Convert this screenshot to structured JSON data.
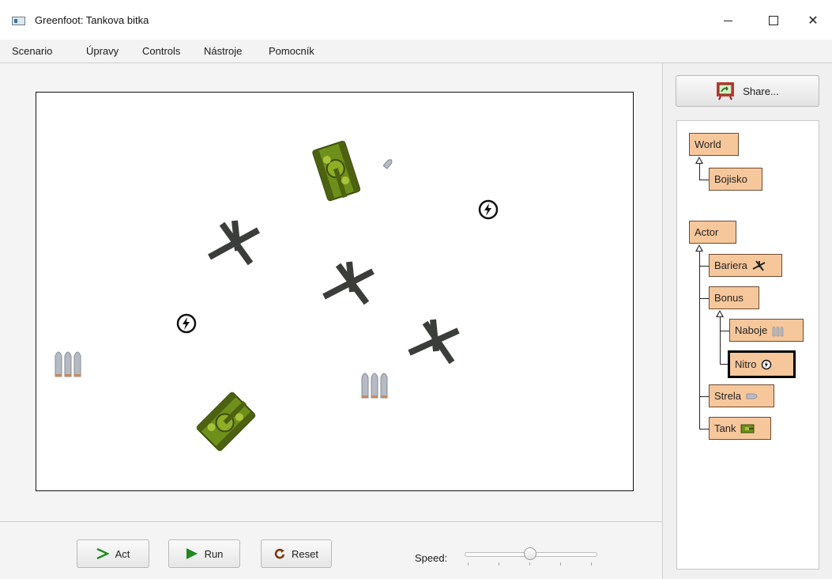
{
  "window": {
    "title": "Greenfoot: Tankova bitka",
    "minimize_glyph": "—",
    "maximize_glyph": "☐",
    "close_glyph": "✕"
  },
  "menu": [
    "Scenario",
    "Úpravy",
    "Controls",
    "Nástroje",
    "Pomocník"
  ],
  "controls": {
    "act_label": "Act",
    "run_label": "Run",
    "reset_label": "Reset",
    "speed_label": "Speed:",
    "speed_level": 0.5
  },
  "share": {
    "label": "Share..."
  },
  "class_tree": {
    "world_root": "World",
    "world_sub": "Bojisko",
    "actor_root": "Actor",
    "bariera": "Bariera",
    "bonus": "Bonus",
    "naboje": "Naboje",
    "nitro": "Nitro",
    "strela": "Strela",
    "tank": "Tank",
    "selected": "Nitro"
  },
  "colors": {
    "class_fill": "#f7c79c",
    "run_green": "#1e8a1e",
    "reset_brown": "#7a3b12",
    "tank_green": "#7a9a1c"
  },
  "icons": [
    "app-icon",
    "share-icon",
    "act-icon",
    "run-icon",
    "reset-icon",
    "barrier-icon",
    "ammo-icon",
    "nitro-icon",
    "bullet-icon",
    "tank-icon"
  ]
}
